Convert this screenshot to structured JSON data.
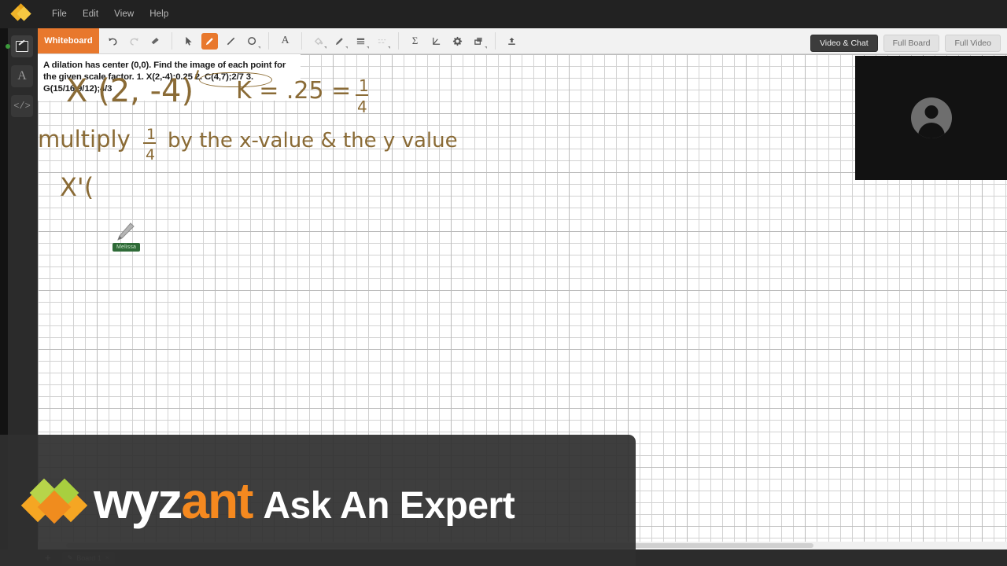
{
  "menubar": {
    "logo_icon": "wyzant-diamond-icon",
    "items": [
      "File",
      "Edit",
      "View",
      "Help"
    ]
  },
  "left_rail": {
    "items": [
      {
        "label": "Whiteboard",
        "icon": "whiteboard-icon",
        "active": true,
        "status_dot": "online"
      },
      {
        "label": "Text",
        "icon": "text-A-icon",
        "active": false
      },
      {
        "label": "Code",
        "icon": "code-brackets-icon",
        "active": false
      }
    ]
  },
  "toolbar": {
    "tab_label": "Whiteboard",
    "tools": [
      {
        "name": "undo-icon",
        "label": "Undo",
        "state": "enabled"
      },
      {
        "name": "redo-icon",
        "label": "Redo",
        "state": "disabled"
      },
      {
        "name": "eraser-icon",
        "label": "Eraser",
        "state": "enabled"
      },
      {
        "name": "select-arrow-icon",
        "label": "Select",
        "state": "enabled"
      },
      {
        "name": "pen-icon",
        "label": "Pen",
        "state": "active"
      },
      {
        "name": "line-icon",
        "label": "Line",
        "state": "enabled"
      },
      {
        "name": "shape-circle-icon",
        "label": "Shape",
        "state": "enabled"
      },
      {
        "name": "text-A-icon",
        "label": "Text",
        "state": "enabled"
      },
      {
        "name": "fill-bucket-icon",
        "label": "Fill",
        "state": "disabled"
      },
      {
        "name": "pen-color-icon",
        "label": "Pen color",
        "state": "enabled"
      },
      {
        "name": "line-weight-icon",
        "label": "Line weight",
        "state": "enabled"
      },
      {
        "name": "line-style-icon",
        "label": "Line style",
        "state": "disabled"
      },
      {
        "name": "sigma-math-icon",
        "label": "Math equation",
        "state": "enabled"
      },
      {
        "name": "graph-axes-icon",
        "label": "Graph",
        "state": "enabled"
      },
      {
        "name": "gear-icon",
        "label": "Settings",
        "state": "enabled"
      },
      {
        "name": "layers-icon",
        "label": "Layers",
        "state": "enabled"
      },
      {
        "name": "upload-icon",
        "label": "Upload",
        "state": "enabled"
      }
    ]
  },
  "view_buttons": [
    {
      "label": "Video & Chat",
      "active": true
    },
    {
      "label": "Full Board",
      "active": false
    },
    {
      "label": "Full Video",
      "active": false
    }
  ],
  "problem": {
    "text": "A dilation has center (0,0). Find the image of each point for the given scale factor. 1. X(2,-4);0.25 2. C(4,7);2/7 3. G(15/16,9/12);4/3",
    "highlight_annotation": "1. X(2,-4);0.25"
  },
  "handwriting": {
    "line1_point": "X (2, -4)",
    "line1_scale": "K = .25 =",
    "line1_fraction": "1/4",
    "line2_prefix": "multiply",
    "line2_fraction": "1/4",
    "line2_rest": "by the  x-value & the y value",
    "line3": "X'(",
    "ink_color": "#8a6b36"
  },
  "cursor": {
    "icon": "pencil-cursor-icon",
    "user_name": "Melissa",
    "badge_color": "#2f6b38"
  },
  "video_panel": {
    "avatar_icon": "user-avatar-icon",
    "background": "#121212"
  },
  "bottom_bar": {
    "add_label": "+",
    "board_tab": {
      "label": "Board 1",
      "icon": "pencil-icon",
      "close": "×"
    }
  },
  "overlay": {
    "brand_part1": "wyz",
    "brand_part2": "ant",
    "tagline": "Ask An Expert",
    "logo_icon": "wyzant-chevron-logo",
    "brand_orange": "#f5891f"
  }
}
